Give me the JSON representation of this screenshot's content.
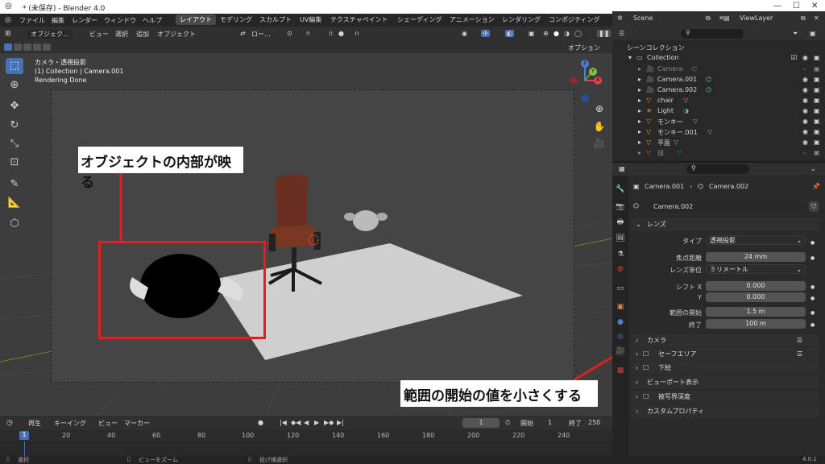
{
  "title_bar": {
    "title": "* (未保存) - Blender 4.0"
  },
  "menu": {
    "items": [
      "ファイル",
      "編集",
      "レンダー",
      "ウィンドウ",
      "ヘルプ"
    ],
    "workspaces": [
      "レイアウト",
      "モデリング",
      "スカルプト",
      "UV編集",
      "テクスチャペイント",
      "シェーディング",
      "アニメーション",
      "レンダリング",
      "コンポジティング"
    ],
    "active_workspace": "レイアウト"
  },
  "viewport_header": {
    "mode": "オブジェク...",
    "menus": [
      "ビュー",
      "選択",
      "追加",
      "オブジェクト"
    ],
    "transform": "ロー...",
    "options": "オプション"
  },
  "viewport_info": {
    "line1": "カメラ・透視投影",
    "line2": "(1) Collection | Camera.001",
    "line3": "Rendering Done"
  },
  "gizmo": {
    "z": "Z",
    "y": "Y",
    "x": "X"
  },
  "annotations": {
    "label1": "オブジェクトの内部が映る",
    "label2": "範囲の開始の値を小さくする",
    "color": "#e02020"
  },
  "timeline": {
    "playback": "再生",
    "keying": "キーイング",
    "view": "ビュー",
    "marker": "マーカー",
    "current_frame": "1",
    "start_label": "開始",
    "start": "1",
    "end_label": "終了",
    "end": "250",
    "ruler": [
      "20",
      "40",
      "60",
      "80",
      "100",
      "120",
      "140",
      "160",
      "180",
      "200",
      "220",
      "240"
    ],
    "cursor_frame": "1"
  },
  "status_bar": {
    "select": "選択",
    "zoom": "ビューをズーム",
    "lasso": "投げ縄選択",
    "version": "4.0.1"
  },
  "outliner": {
    "scene": "Scene",
    "view_layer": "ViewLayer",
    "root": "シーンコレクション",
    "collection": "Collection",
    "items": [
      {
        "name": "Camera",
        "dim": true
      },
      {
        "name": "Camera.001",
        "dim": false
      },
      {
        "name": "Camera.002",
        "dim": false
      },
      {
        "name": "chair",
        "dim": false
      },
      {
        "name": "Light",
        "dim": false
      },
      {
        "name": "モンキー",
        "dim": false
      },
      {
        "name": "モンキー.001",
        "dim": false
      },
      {
        "name": "平面",
        "dim": false
      },
      {
        "name": "球",
        "dim": true
      }
    ]
  },
  "properties": {
    "breadcrumb_object": "Camera.001",
    "breadcrumb_data": "Camera.002",
    "data_name": "Camera.002",
    "lens_section": "レンズ",
    "type_label": "タイプ",
    "type_value": "透視投影",
    "focal_label": "焦点距離",
    "focal_value": "24 mm",
    "unit_label": "レンズ単位",
    "unit_value": "ミリメートル",
    "shift_label": "シフト X",
    "shift_x": "0.000",
    "shift_y_label": "Y",
    "shift_y": "0.000",
    "clip_start_label": "範囲の開始",
    "clip_start": "1.5 m",
    "clip_end_label": "終了",
    "clip_end": "100 m",
    "sections": [
      "カメラ",
      "セーフエリア",
      "下絵",
      "ビューポート表示",
      "被写界深度",
      "カスタムプロパティ"
    ]
  }
}
